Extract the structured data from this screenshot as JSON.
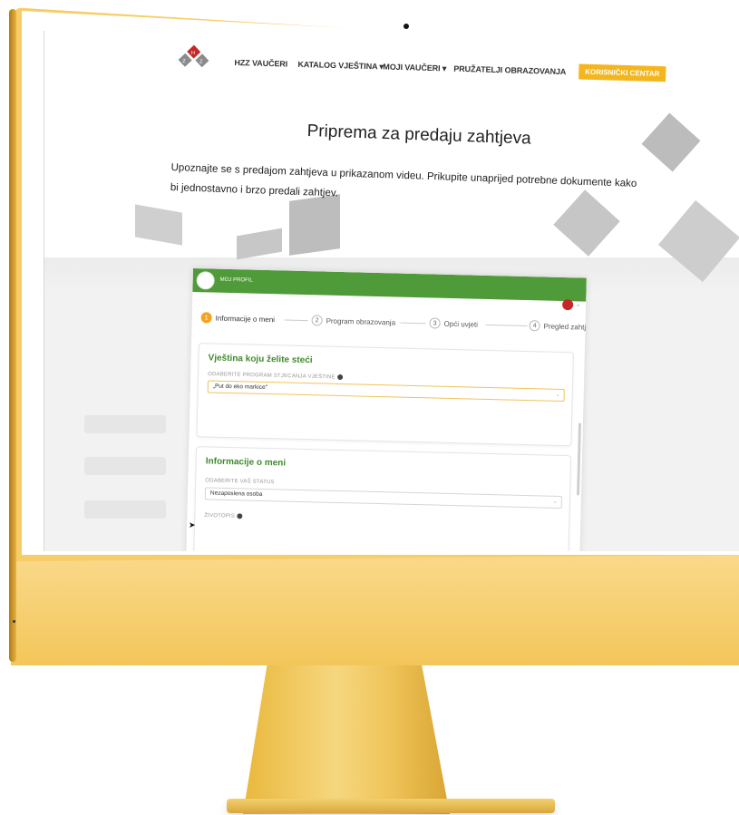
{
  "nav": {
    "items": [
      {
        "label": "HZZ VAUČERI",
        "name": "nav-hzz-vauceri"
      },
      {
        "label": "KATALOG VJEŠTINA ▾",
        "name": "nav-katalog-vjestina"
      },
      {
        "label": "MOJI VAUČERI ▾",
        "name": "nav-moji-vauceri"
      },
      {
        "label": "PRUŽATELJI OBRAZOVANJA",
        "name": "nav-pruzatelji"
      }
    ],
    "cta": "KORISNIČKI CENTAR",
    "accent": "#f4b61e"
  },
  "hero": {
    "title": "Priprema za predaju zahtjeva",
    "intro": "Upoznajte se s predajom zahtjeva u prikazanom videu. Prikupite unaprijed potrebne dokumente kako bi jednostavno i brzo predali zahtjev."
  },
  "app": {
    "header": {
      "profile_label": "MOJ PROFIL",
      "color": "#4f9a39"
    },
    "steps": [
      {
        "number": "1",
        "label": "Informacije o meni",
        "active": true
      },
      {
        "number": "2",
        "label": "Program obrazovanja",
        "active": false
      },
      {
        "number": "3",
        "label": "Opći uvjeti",
        "active": false
      },
      {
        "number": "4",
        "label": "Pregled zahtjeva",
        "active": false
      }
    ],
    "skill_card": {
      "title": "Vještina koju želite steći",
      "field_label": "ODABERITE PROGRAM STJECANJA VJEŠTINE",
      "value": "„Put do eko markice\""
    },
    "info_card": {
      "title": "Informacije o meni",
      "status_label": "ODABERITE VAŠ STATUS",
      "status_value": "Nezaposlena osoba",
      "cv_label": "ŽIVOTOPIS"
    }
  },
  "hardware": {
    "body_color": "#f6cd67"
  }
}
